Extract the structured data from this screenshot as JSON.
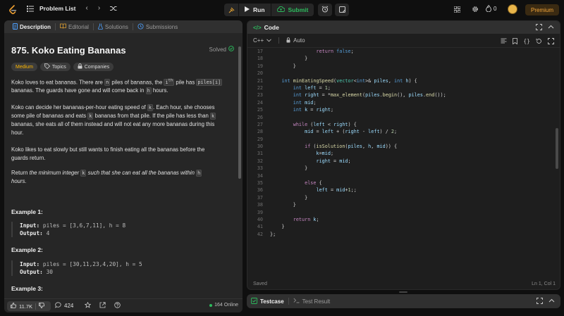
{
  "topbar": {
    "problem_list": "Problem List",
    "run": "Run",
    "submit": "Submit",
    "coins": "0",
    "premium": "Premium"
  },
  "left_tabs": [
    {
      "label": "Description",
      "icon": "document-icon"
    },
    {
      "label": "Editorial",
      "icon": "book-icon"
    },
    {
      "label": "Solutions",
      "icon": "flask-icon"
    },
    {
      "label": "Submissions",
      "icon": "history-icon"
    }
  ],
  "problem": {
    "title": "875. Koko Eating Bananas",
    "status": "Solved",
    "difficulty": "Medium",
    "topics": "Topics",
    "companies": "Companies",
    "p1_a": "Koko loves to eat bananas. There are ",
    "p1_n": "n",
    "p1_b": " piles of bananas, the ",
    "p1_i": "i",
    "p1_sup": "th",
    "p1_c": " pile has ",
    "p1_piles": "piles[i]",
    "p1_d": "bananas. The guards have gone and will come back in ",
    "p1_h": "h",
    "p1_e": " hours.",
    "p2_a": "Koko can decide her bananas-per-hour eating speed of ",
    "p2_k": "k",
    "p2_b": ". Each hour, she chooses",
    "p2_c": "some pile of bananas and eats ",
    "p2_k2": "k",
    "p2_d": " bananas from that pile. If the pile has less than ",
    "p2_k3": "k",
    "p2_e": "bananas, she eats all of them instead and will not eat any more bananas during this",
    "p2_f": "hour.",
    "p3_a": "Koko likes to eat slowly but still wants to finish eating all the bananas before the",
    "p3_b": "guards return.",
    "p4_a": "Return ",
    "p4_b": "the minimum integer",
    "p4_k": "k",
    "p4_c": "such that she can eat all the bananas within",
    "p4_h": "h",
    "p4_d": "hours.",
    "ex1_title": "Example 1:",
    "ex1_input_label": "Input:",
    "ex1_input": "piles = [3,6,7,11], h = 8",
    "ex1_output_label": "Output:",
    "ex1_output": "4",
    "ex2_title": "Example 2:",
    "ex2_input_label": "Input:",
    "ex2_input": "piles = [30,11,23,4,20], h = 5",
    "ex2_output_label": "Output:",
    "ex2_output": "30",
    "ex3_title": "Example 3:"
  },
  "footer": {
    "likes": "11.7K",
    "comments": "424",
    "online": "164 Online"
  },
  "code": {
    "title": "Code",
    "language": "C++",
    "auto": "Auto",
    "status": "Saved",
    "cursor": "Ln 1, Col 1"
  },
  "test": {
    "testcase": "Testcase",
    "result": "Test Result"
  },
  "colors": {
    "accent_green": "#2cbb5d",
    "medium_yellow": "#ffb800",
    "premium_orange": "#f4a63a"
  }
}
